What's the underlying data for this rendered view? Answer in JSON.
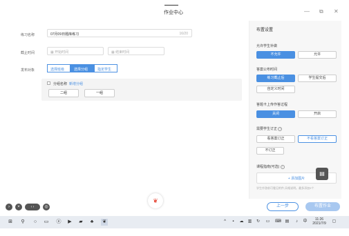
{
  "window": {
    "title": "作业中心",
    "minimize": "—",
    "restore": "⧉",
    "close": "✕"
  },
  "form": {
    "name_label": "练习名称",
    "name_value": "07月09日题库练习",
    "name_counter": "16/20",
    "deadline_label": "截止时间",
    "deadline_start_placeholder": "开始时间",
    "deadline_end_placeholder": "结束时间",
    "target_label": "发布对象",
    "target_tabs": [
      "选择班级",
      "选择分组",
      "指定学生"
    ],
    "class_check_label": "分组名称",
    "class_link": "新增分组",
    "classes": [
      "二组",
      "一组"
    ]
  },
  "sidebar": {
    "title": "布置设置",
    "sections": [
      {
        "label": "允许学生补做",
        "options": [
          "不允许",
          "允许"
        ],
        "active": 0
      },
      {
        "label": "答案公布时间",
        "options": [
          "练习截止后",
          "学生提交后",
          "自定义时间"
        ],
        "active": 0
      },
      {
        "label": "答题卡上传作答过程",
        "options": [
          "关闭",
          "开启"
        ],
        "active": 0
      },
      {
        "label": "需要学生订正",
        "options": [
          "看答案订正",
          "不看答案订正",
          "不订正"
        ],
        "active": 1
      }
    ],
    "notes_label": "课程指南(可选)",
    "add_link": "+ 添加图片",
    "hint": "学生作答前可看见附件,风格说明。最多添加9个"
  },
  "bottom": {
    "prev": "上一步",
    "publish": "布置作业"
  },
  "taskbar": {
    "time": "11:26",
    "date": "2021/7/9"
  }
}
